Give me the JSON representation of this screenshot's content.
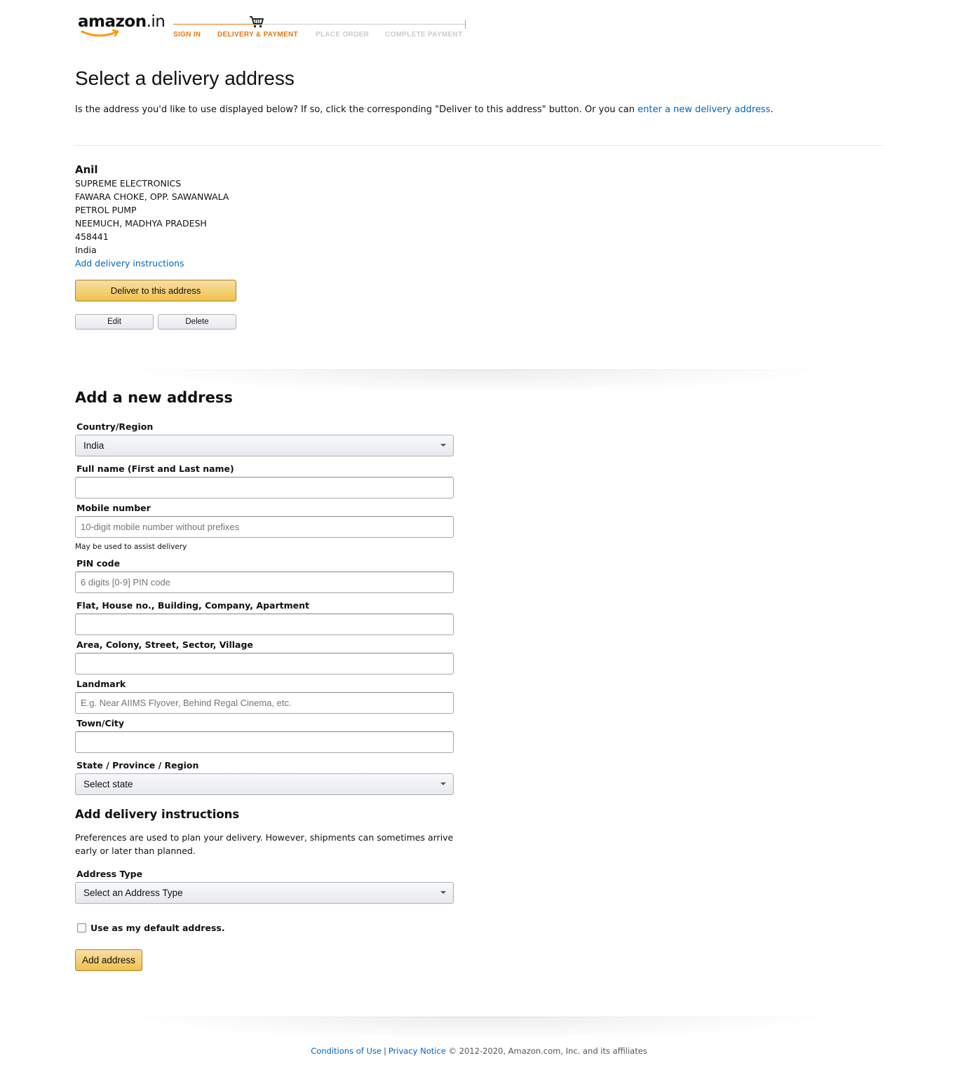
{
  "header": {
    "logo_text": "amazon",
    "logo_suffix": ".in",
    "steps": [
      {
        "label": "SIGN IN",
        "state": "active"
      },
      {
        "label": "DELIVERY & PAYMENT",
        "state": "active"
      },
      {
        "label": "PLACE ORDER",
        "state": "inactive"
      },
      {
        "label": "COMPLETE PAYMENT",
        "state": "inactive"
      }
    ],
    "cart_icon": "cart-icon"
  },
  "page": {
    "title": "Select a delivery address",
    "intro_text": "Is the address you'd like to use displayed below? If so, click the corresponding \"Deliver to this address\" button. Or you can ",
    "intro_link": "enter a new delivery address",
    "intro_end": "."
  },
  "address": {
    "name": "Anil",
    "lines": [
      "SUPREME ELECTRONICS",
      "FAWARA CHOKE, OPP. SAWANWALA",
      "PETROL PUMP",
      "NEEMUCH, MADHYA PRADESH",
      "458441",
      "India"
    ],
    "instructions_link": "Add delivery instructions",
    "deliver_button": "Deliver to this address",
    "edit_button": "Edit",
    "delete_button": "Delete"
  },
  "new_address": {
    "title": "Add a new address",
    "country_label": "Country/Region",
    "country_value": "India",
    "fullname_label": "Full name (First and Last name)",
    "fullname_value": "",
    "mobile_label": "Mobile number",
    "mobile_placeholder": "10-digit mobile number without prefixes",
    "mobile_hint": "May be used to assist delivery",
    "pin_label": "PIN code",
    "pin_placeholder": "6 digits [0-9] PIN code",
    "flat_label": "Flat, House no., Building, Company, Apartment",
    "area_label": "Area, Colony, Street, Sector, Village",
    "landmark_label": "Landmark",
    "landmark_placeholder": "E.g. Near AIIMS Flyover, Behind Regal Cinema, etc.",
    "town_label": "Town/City",
    "state_label": "State / Province / Region",
    "state_value": "Select state",
    "instructions_title": "Add delivery instructions",
    "instructions_text": "Preferences are used to plan your delivery. However, shipments can sometimes arrive early or later than planned.",
    "address_type_label": "Address Type",
    "address_type_value": "Select an Address Type",
    "default_checkbox_label": "Use as my default address.",
    "default_checked": false,
    "add_button": "Add address"
  },
  "footer": {
    "conditions_link": "Conditions of Use",
    "separator": "|",
    "privacy_link": "Privacy Notice",
    "copyright": "© 2012-2020, Amazon.com, Inc. and its affiliates"
  },
  "colors": {
    "accent_orange": "#e47911",
    "link_blue": "#0066c0",
    "button_yellow": "#f0c14b"
  }
}
